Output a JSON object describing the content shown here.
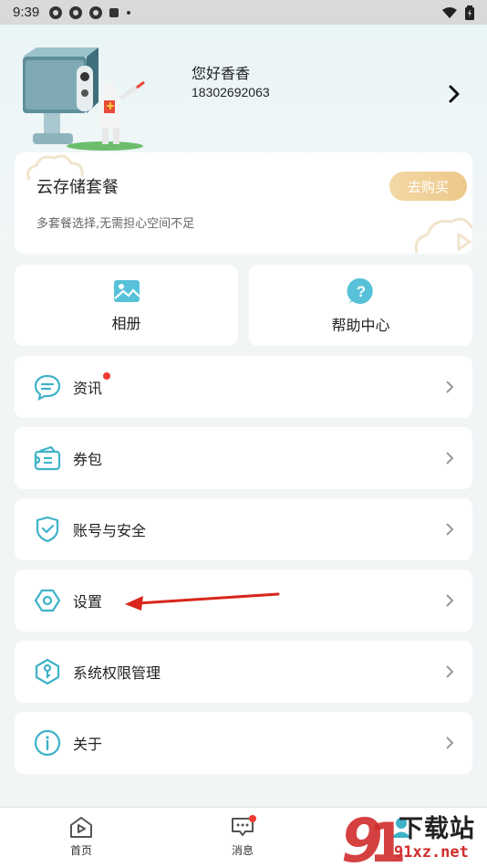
{
  "status_bar": {
    "time": "9:39"
  },
  "profile": {
    "username": "您好香香",
    "phone": "18302692063"
  },
  "cloud": {
    "title": "云存储套餐",
    "subtitle": "多套餐选择,无需担心空间不足",
    "buy_label": "去购买"
  },
  "quick": [
    {
      "label": "相册",
      "icon": "album-icon"
    },
    {
      "label": "帮助中心",
      "icon": "help-icon"
    }
  ],
  "menu": [
    {
      "label": "资讯",
      "icon": "news-icon",
      "badge": true
    },
    {
      "label": "券包",
      "icon": "wallet-icon"
    },
    {
      "label": "账号与安全",
      "icon": "shield-icon"
    },
    {
      "label": "设置",
      "icon": "settings-icon"
    },
    {
      "label": "系统权限管理",
      "icon": "key-icon"
    },
    {
      "label": "关于",
      "icon": "info-icon"
    }
  ],
  "nav": {
    "home": "首页",
    "messages": "消息"
  },
  "watermark": {
    "text": "下载站",
    "url": "91xz.net"
  },
  "colors": {
    "accent": "#3eb2c8",
    "badge": "#ee3b2f",
    "buy": "#edc88a"
  }
}
